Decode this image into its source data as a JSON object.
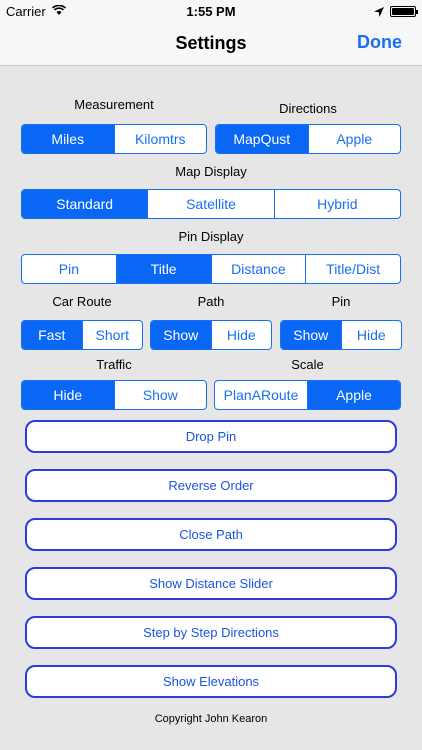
{
  "status": {
    "carrier": "Carrier",
    "time": "1:55 PM"
  },
  "nav": {
    "title": "Settings",
    "done": "Done"
  },
  "measurement": {
    "label": "Measurement",
    "options": [
      "Miles",
      "Kilomtrs"
    ],
    "selected": 0
  },
  "directions": {
    "label": "Directions",
    "options": [
      "MapQust",
      "Apple"
    ],
    "selected": 0
  },
  "map_display": {
    "label": "Map Display",
    "options": [
      "Standard",
      "Satellite",
      "Hybrid"
    ],
    "selected": 0
  },
  "pin_display": {
    "label": "Pin Display",
    "options": [
      "Pin",
      "Title",
      "Distance",
      "Title/Dist"
    ],
    "selected": 1
  },
  "car_route": {
    "label": "Car Route",
    "options": [
      "Fast",
      "Short"
    ],
    "selected": 0
  },
  "path": {
    "label": "Path",
    "options": [
      "Show",
      "Hide"
    ],
    "selected": 0
  },
  "pin": {
    "label": "Pin",
    "options": [
      "Show",
      "Hide"
    ],
    "selected": 0
  },
  "traffic": {
    "label": "Traffic",
    "options": [
      "Hide",
      "Show"
    ],
    "selected": 0
  },
  "scale": {
    "label": "Scale",
    "options": [
      "PlanARoute",
      "Apple"
    ],
    "selected": 1
  },
  "buttons": [
    "Drop Pin",
    "Reverse Order",
    "Close Path",
    "Show Distance Slider",
    "Step by Step Directions",
    "Show Elevations"
  ],
  "copyright": "Copyright John Kearon",
  "colors": {
    "accent": "#1a6ff0",
    "button_border": "#2d3ae0",
    "background": "#e6e6e6"
  }
}
